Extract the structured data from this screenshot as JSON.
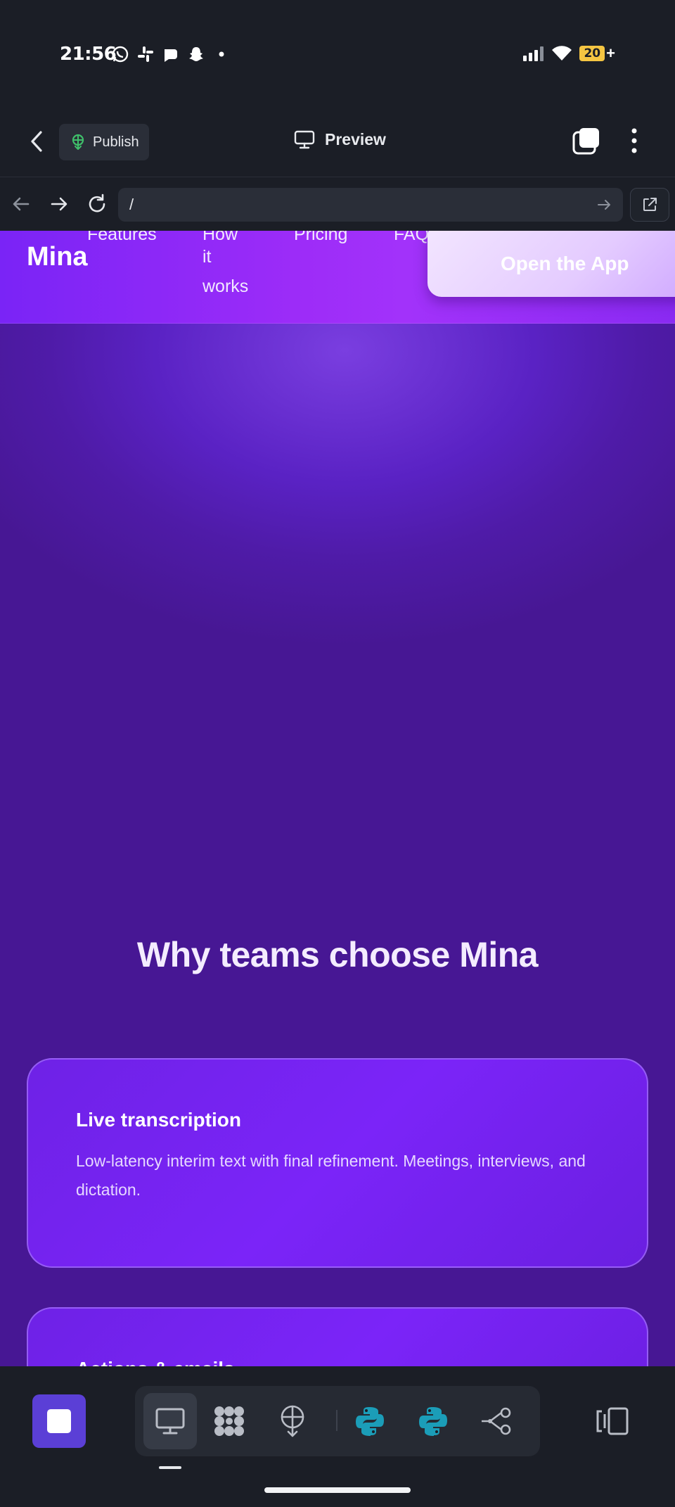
{
  "status_bar": {
    "time": "21:56",
    "notification_icons": [
      "whatsapp-icon",
      "slack-icon",
      "chat-icon",
      "snapchat-icon",
      "dot-icon"
    ],
    "battery": "20",
    "battery_suffix": "+"
  },
  "app_bar": {
    "publish_label": "Publish",
    "preview_label": "Preview"
  },
  "url_bar": {
    "value": "/"
  },
  "site": {
    "brand": "Mina",
    "nav": {
      "features": "Features",
      "how_it_works_1": "How",
      "how_it_works_2": "it",
      "how_it_works_3": "works",
      "pricing": "Pricing",
      "faq": "FAQ"
    },
    "cta_label": "Open the App",
    "section_title": "Why teams choose Mina",
    "cards": [
      {
        "title": "Live transcription",
        "description": "Low-latency interim text with final refinement. Meetings, interviews, and dictation."
      },
      {
        "title": "Actions & emails"
      }
    ]
  },
  "toolbar": {
    "tools": [
      "desktop-icon",
      "apps-icon",
      "deploy-icon",
      "python-icon",
      "python-icon",
      "workflow-icon"
    ],
    "colors": {
      "stop": "#5b3fd6",
      "python": "#1b9db8",
      "site_accent": "#7b24f8"
    }
  }
}
